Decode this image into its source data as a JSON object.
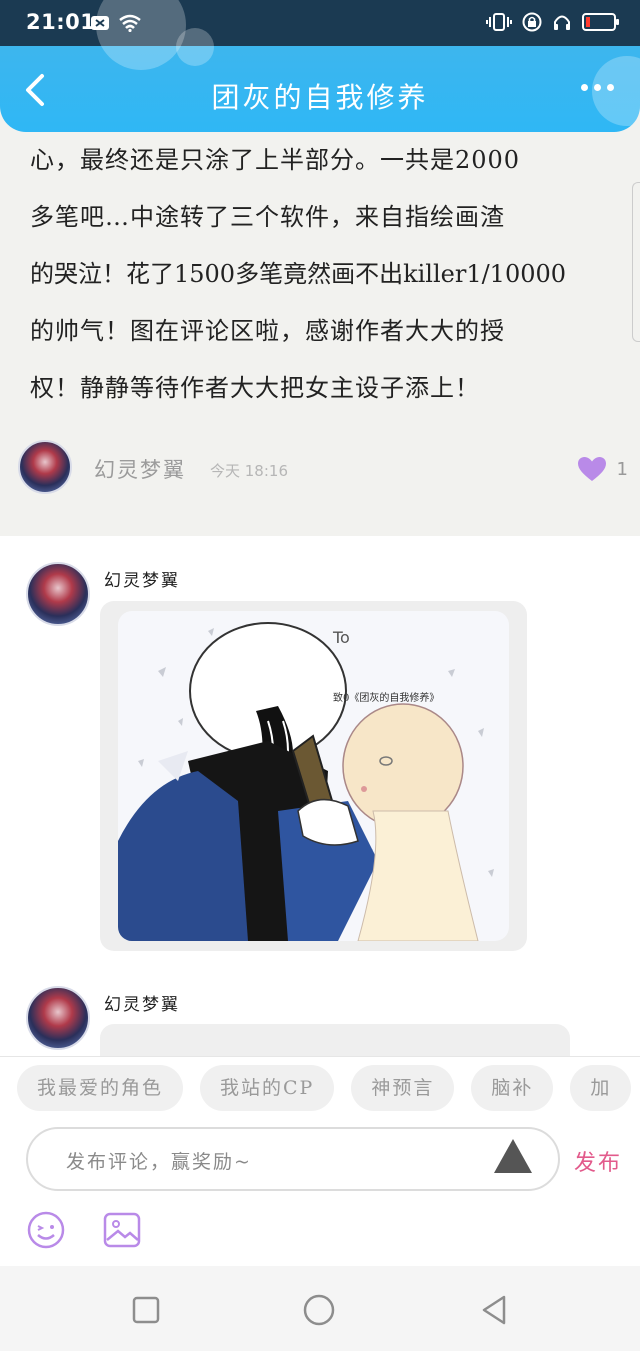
{
  "status_bar": {
    "time": "21:01"
  },
  "header": {
    "title": "团灰的自我修养"
  },
  "post": {
    "lines": [
      "心，最终还是只涂了上半部分。一共是2000",
      "多笔吧…中途转了三个软件，来自指绘画渣",
      "的哭泣！花了1500多笔竟然画不出killer1/10000",
      "的帅气！图在评论区啦，感谢作者大大的授",
      "权！静静等待作者大大把女主设子添上！"
    ],
    "author": "幻灵梦翼",
    "time": "今天 18:16",
    "likes": "1"
  },
  "comments": [
    {
      "author": "幻灵梦翼",
      "image_text_to": "To",
      "image_text_dedication": "致0《团灰的自我修养》"
    },
    {
      "author": "幻灵梦翼"
    }
  ],
  "composer": {
    "tags": [
      "我最爱的角色",
      "我站的CP",
      "神预言",
      "脑补",
      "加"
    ],
    "placeholder": "发布评论，赢奖励~",
    "send_label": "发布"
  },
  "colors": {
    "header_blue": "#2fb7f5",
    "accent_pink": "#e25a8b",
    "like_purple": "#b98ae8"
  }
}
